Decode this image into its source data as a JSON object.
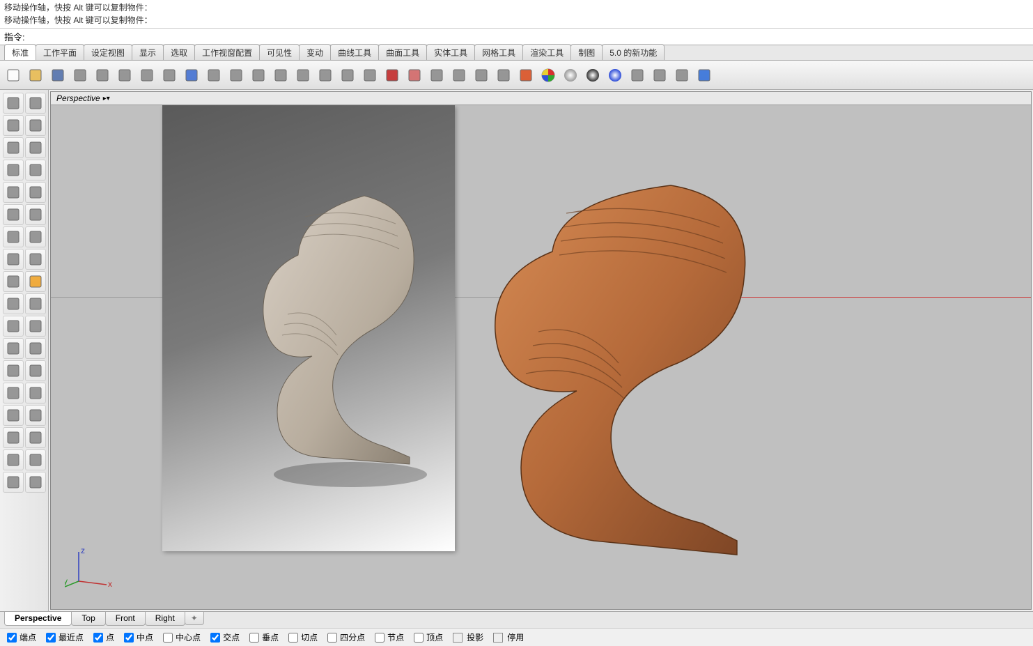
{
  "command_history": [
    "移动操作轴，快按 Alt 键可以复制物件：",
    "移动操作轴，快按 Alt 键可以复制物件："
  ],
  "command_prompt": "指令:",
  "command_value": "",
  "menu_tabs": [
    "标准",
    "工作平面",
    "设定视图",
    "显示",
    "选取",
    "工作视窗配置",
    "可见性",
    "变动",
    "曲线工具",
    "曲面工具",
    "实体工具",
    "网格工具",
    "渲染工具",
    "制图",
    "5.0 的新功能"
  ],
  "active_menu_tab": 0,
  "toolbar_icons": [
    "new-file",
    "open-file",
    "save-file",
    "print",
    "clipboard-paste",
    "cut",
    "copy",
    "paste-special",
    "undo",
    "pan-hand",
    "crosshair",
    "zoom-out",
    "zoom-in",
    "zoom-selection",
    "zoom-extents",
    "zoom-dynamic",
    "grid-toggle",
    "car-preview",
    "erase",
    "layer-state",
    "layers-panel",
    "light-toggle",
    "lock",
    "render-material",
    "color-wheel",
    "sphere-gray",
    "sphere-dark",
    "sphere-blue",
    "wand",
    "gear-move",
    "align",
    "help"
  ],
  "side_tools": [
    [
      "pointer-arrow",
      "point-single"
    ],
    [
      "line",
      "polyline-rect"
    ],
    [
      "circle",
      "ellipse"
    ],
    [
      "triangle-curve",
      "rectangle"
    ],
    [
      "arc",
      "fillet-curve"
    ],
    [
      "freeform",
      "blob"
    ],
    [
      "box-solid",
      "cylinder-solid"
    ],
    [
      "torus",
      "plane"
    ],
    [
      "puzzle",
      "flame"
    ],
    [
      "pencil-edit",
      "eraser-edit"
    ],
    [
      "boolean",
      "snap-point"
    ],
    [
      "curve-edit",
      "network"
    ],
    [
      "text",
      "scale-arrow"
    ],
    [
      "array",
      "extract"
    ],
    [
      "block",
      "grip"
    ],
    [
      "grid-dots",
      "handle"
    ],
    [
      "box-wire",
      "check-ok"
    ],
    [
      "hex-left",
      "hex-right"
    ]
  ],
  "viewport": {
    "title": "Perspective",
    "axis": {
      "x": "x",
      "y": "y",
      "z": "z"
    }
  },
  "view_tabs": [
    "Perspective",
    "Top",
    "Front",
    "Right"
  ],
  "active_view_tab": 0,
  "osnap": [
    {
      "label": "端点",
      "checked": true
    },
    {
      "label": "最近点",
      "checked": true
    },
    {
      "label": "点",
      "checked": true
    },
    {
      "label": "中点",
      "checked": true
    },
    {
      "label": "中心点",
      "checked": false
    },
    {
      "label": "交点",
      "checked": true
    },
    {
      "label": "垂点",
      "checked": false
    },
    {
      "label": "切点",
      "checked": false
    },
    {
      "label": "四分点",
      "checked": false
    },
    {
      "label": "节点",
      "checked": false
    },
    {
      "label": "顶点",
      "checked": false
    }
  ],
  "osnap_toggles": [
    "投影",
    "停用"
  ]
}
